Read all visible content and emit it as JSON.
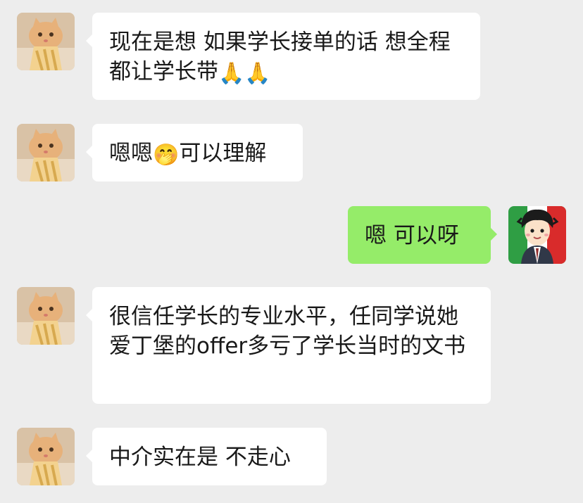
{
  "chat": {
    "messages": [
      {
        "sender": "other",
        "avatar_icon": "cat-avatar-icon",
        "text": "现在是想 如果学长接单的话 想全程都让学长带",
        "emojis": [
          "🙏",
          "🙏"
        ]
      },
      {
        "sender": "other",
        "avatar_icon": "cat-avatar-icon",
        "text_before": "嗯嗯",
        "emoji": "🤭",
        "text_after": "可以理解"
      },
      {
        "sender": "self",
        "avatar_icon": "cartoon-boy-avatar-icon",
        "text": "嗯 可以呀"
      },
      {
        "sender": "other",
        "avatar_icon": "cat-avatar-icon",
        "text": "很信任学长的专业水平，任同学说她爱丁堡的offer多亏了学长当时的文书"
      },
      {
        "sender": "other",
        "avatar_icon": "cat-avatar-icon",
        "text": "中介实在是 不走心"
      }
    ]
  },
  "colors": {
    "background": "#ededed",
    "incoming_bubble": "#ffffff",
    "outgoing_bubble": "#95ec69",
    "text": "#191919"
  }
}
